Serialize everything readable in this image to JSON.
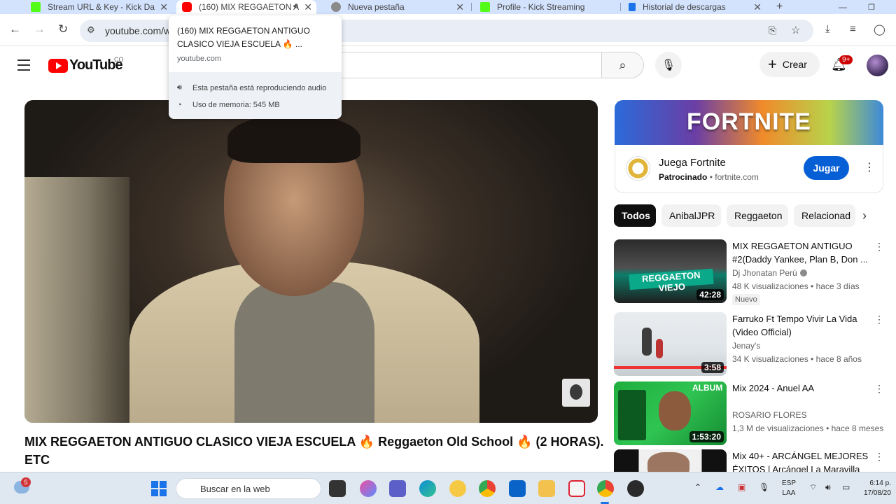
{
  "browser": {
    "tabs": [
      {
        "title": "Stream URL & Key - Kick Da",
        "close": "✕"
      },
      {
        "title": "(160) MIX REGGAETON A",
        "close": "✕"
      },
      {
        "title": "Nueva pestaña",
        "close": "✕"
      },
      {
        "title": "Profile - Kick Streaming",
        "close": "✕"
      },
      {
        "title": "Historial de descargas",
        "close": "✕"
      }
    ],
    "new_tab": "+",
    "url": "youtube.com/w"
  },
  "hovercard": {
    "title": "(160) MIX REGGAETON ANTIGUO CLASICO VIEJA ESCUELA 🔥 ...",
    "domain": "youtube.com",
    "audio": "Esta pestaña está reproduciendo audio",
    "memory": "Uso de memoria: 545 MB"
  },
  "youtube": {
    "logo": "YouTube",
    "country": "CO",
    "create": "Crear",
    "notifications": "9+"
  },
  "video": {
    "title": "MIX REGGAETON ANTIGUO CLASICO VIEJA ESCUELA 🔥 Reggaeton Old School 🔥 (2 HORAS). ETC"
  },
  "ad": {
    "banner": "FORTNITE",
    "name": "Juega Fortnite",
    "sponsored": "Patrocinado",
    "domain": "fortnite.com",
    "button": "Jugar"
  },
  "chips": [
    "Todos",
    "AnibalJPR",
    "Reggaeton",
    "Relacionad"
  ],
  "recommendations": [
    {
      "title": "MIX REGGAETON ANTIGUO #2(Daddy Yankee, Plan B, Don ...",
      "channel": "Dj Jhonatan Perú",
      "stats": "48 K visualizaciones • hace 3 días",
      "duration": "42:28",
      "badge": "Nuevo"
    },
    {
      "title": "Farruko Ft Tempo Vivir La Vida (Video Official)",
      "channel": "Jenay's",
      "stats": "34 K visualizaciones • hace 8 años",
      "duration": "3:58"
    },
    {
      "title": "Mix 2024 - Anuel AA",
      "channel": "ROSARIO FLORES",
      "stats": "1,3 M de visualizaciones • hace 8 meses",
      "duration": "1:53:20"
    },
    {
      "title": "Mix 40+ - ARCÁNGEL MEJORES ÉXITOS | Arcángel La Maravilla",
      "channel": "",
      "stats": "",
      "duration": ""
    }
  ],
  "taskbar": {
    "weather_badge": "5",
    "search": "Buscar en la web",
    "lang1": "ESP",
    "lang2": "LAA",
    "time": "6:14 p.",
    "date": "17/08/20"
  }
}
